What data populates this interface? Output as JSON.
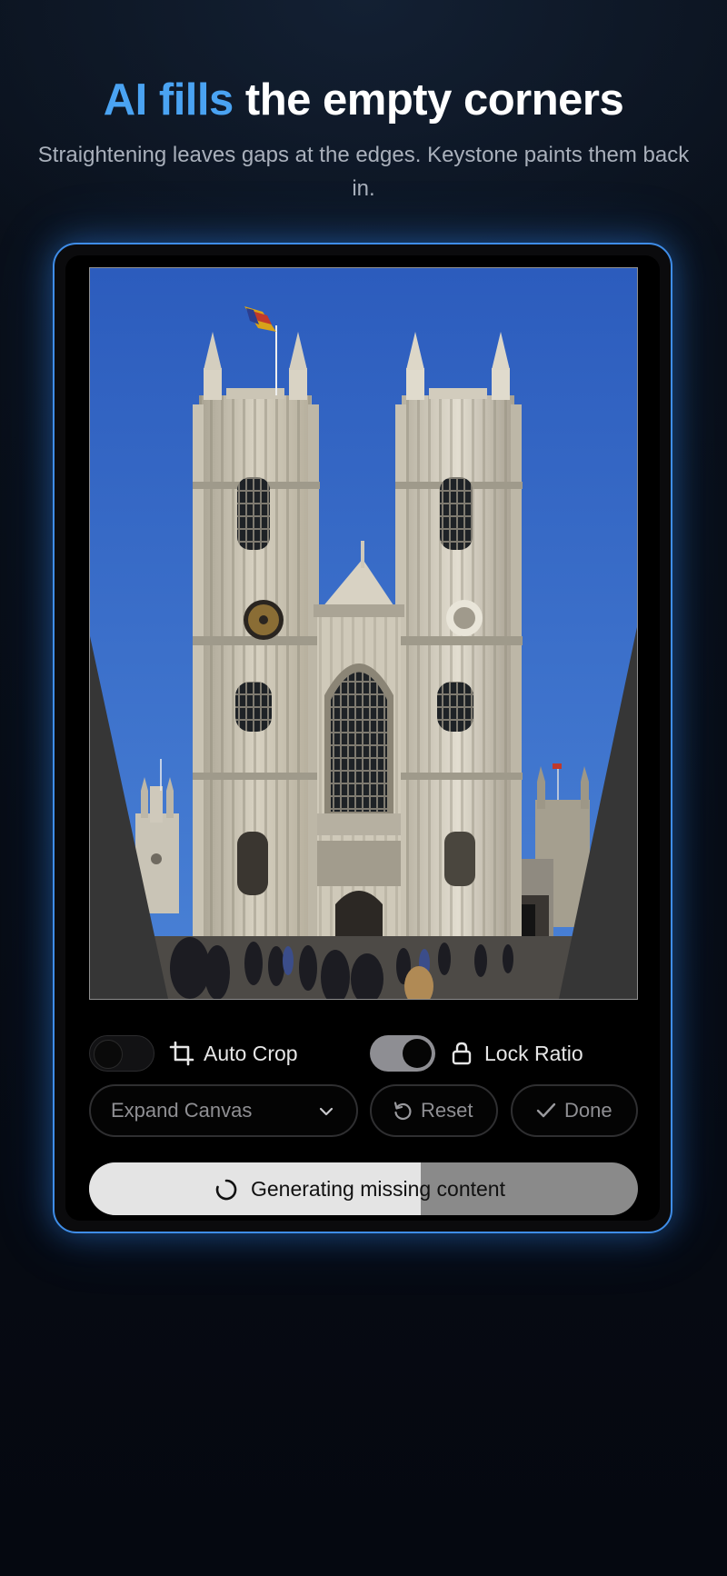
{
  "header": {
    "title_accent": "AI fills",
    "title_rest": "the empty corners",
    "subtitle": "Straightening leaves gaps at the edges. Keystone paints them back in."
  },
  "photo": {
    "description_icon": "cathedral-photo"
  },
  "controls": {
    "auto_crop": {
      "label": "Auto Crop",
      "on": false,
      "icon": "crop-icon"
    },
    "lock_ratio": {
      "label": "Lock Ratio",
      "on": true,
      "icon": "lock-icon"
    },
    "expand_canvas": {
      "label": "Expand Canvas",
      "icon": "chevron-down-icon"
    },
    "reset": {
      "label": "Reset",
      "icon": "rotate-ccw-icon"
    },
    "done": {
      "label": "Done",
      "icon": "checkmark-icon"
    }
  },
  "progress": {
    "label": "Generating missing content",
    "fraction": 0.605,
    "icon": "spinner-icon"
  },
  "colors": {
    "accent": "#4aa3f2",
    "device_border": "#3f8de8",
    "sky": "#2f5fb8"
  }
}
